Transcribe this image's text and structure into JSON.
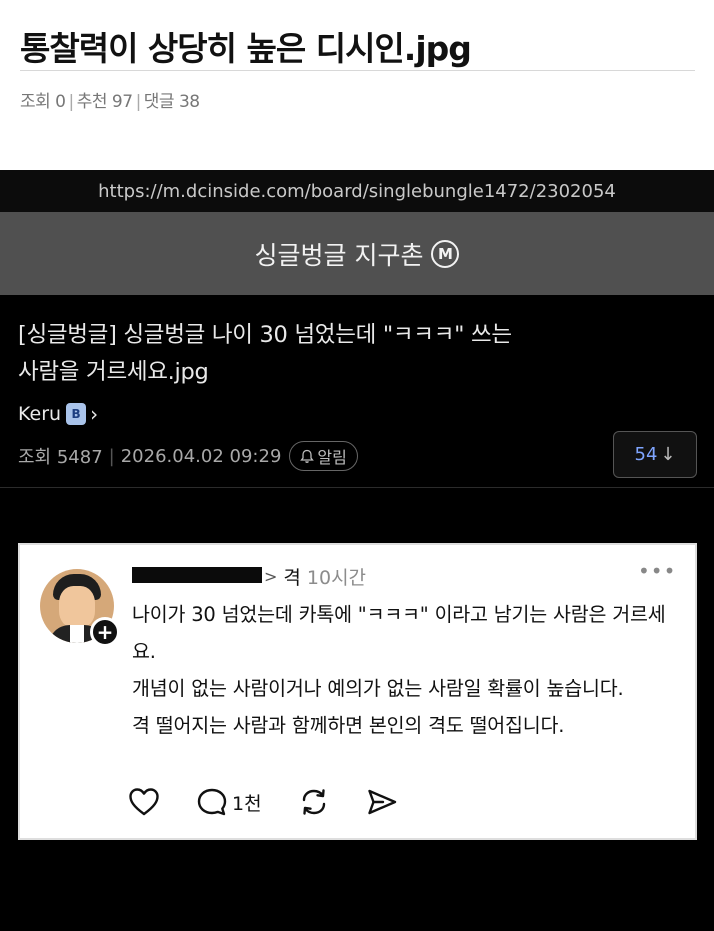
{
  "post": {
    "title": "통찰력이 상당히 높은 디시인.jpg",
    "views_label": "조회 0",
    "recommend_label": "추천 97",
    "comments_label": "댓글 38",
    "separator": "|"
  },
  "screenshot": {
    "url": "https://m.dcinside.com/board/singlebungle1472/2302054",
    "gallery_name": "싱글벙글 지구촌",
    "gallery_badge": "M",
    "thread_title": "[싱글벙글] 싱글벙글 나이 30 넘었는데 \"ㅋㅋㅋ\" 쓰는 사람을 거르세요.jpg",
    "author": "Keru",
    "author_badge": "B",
    "author_chevron": "›",
    "views": "조회 5487",
    "datetime": "2026.04.02 09:29",
    "alarm_label": "알림",
    "reply_count": "54",
    "reply_arrow": "↓"
  },
  "comment": {
    "handle_chevron": ">",
    "handle": "격",
    "time": "10시간",
    "more": "•••",
    "text": "나이가 30 넘었는데 카톡에 \"ㅋㅋㅋ\" 이라고 남기는 사람은 거르세요.\n개념이 없는 사람이거나 예의가 없는 사람일 확률이 높습니다.\n격 떨어지는 사람과 함께하면 본인의 격도 떨어집니다.",
    "reply_count": "1천",
    "plus": "+"
  },
  "icons": {
    "like": "heart-icon",
    "reply": "comment-bubble-icon",
    "repost": "repost-icon",
    "share": "send-icon",
    "alarm": "bell-icon"
  },
  "colors": {
    "page_bg": "#ffffff",
    "shot_bg": "#000000",
    "gallery_bar": "#505050",
    "reply_accent": "#7fa5ff",
    "badge_bg": "#a9c3ea"
  }
}
